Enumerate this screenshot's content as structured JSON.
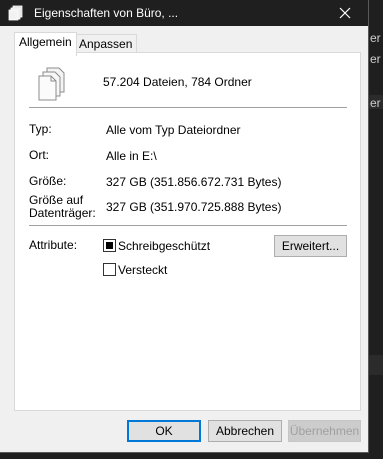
{
  "window": {
    "title": "Eigenschaften von Büro, ...",
    "close_glyph": "✕"
  },
  "background": {
    "edge_chars": [
      "k",
      "k",
      "er",
      "er",
      "er"
    ]
  },
  "tabs": [
    {
      "label": "Allgemein",
      "active": true
    },
    {
      "label": "Anpassen",
      "active": false
    }
  ],
  "summary": "57.204 Dateien, 784 Ordner",
  "props": {
    "type_label": "Typ:",
    "type_value": "Alle vom Typ Dateiordner",
    "location_label": "Ort:",
    "location_value": "Alle in E:\\",
    "size_label": "Größe:",
    "size_value": "327 GB (351.856.672.731 Bytes)",
    "disk_label_line1": "Größe auf",
    "disk_label_line2": "Datenträger:",
    "disk_value": "327 GB (351.970.725.888 Bytes)"
  },
  "attributes": {
    "label": "Attribute:",
    "readonly_label": "Schreibgeschützt",
    "readonly_state": "indeterminate",
    "hidden_label": "Versteckt",
    "hidden_state": "unchecked",
    "advanced_button": "Erweitert..."
  },
  "buttons": {
    "ok": "OK",
    "cancel": "Abbrechen",
    "apply": "Übernehmen"
  },
  "colors": {
    "titlebar": "#1f1f1f",
    "dialog_bg": "#f0f0f0",
    "default_button_border": "#0078d7"
  },
  "icons": {
    "title": "folder-stack-icon",
    "summary": "multiple-files-icon",
    "close": "close-icon"
  }
}
